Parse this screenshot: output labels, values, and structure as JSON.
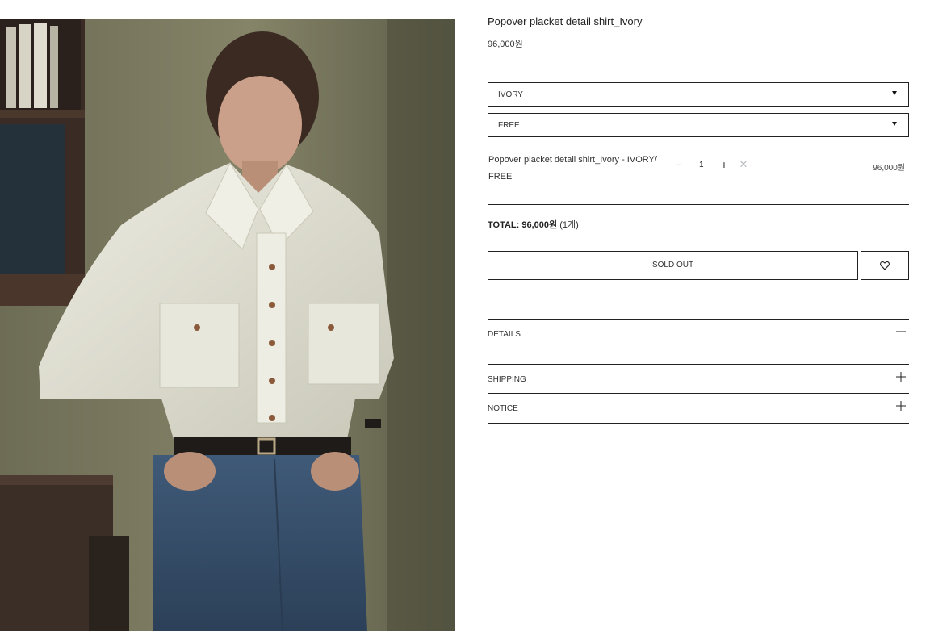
{
  "product": {
    "title": "Popover placket detail shirt_Ivory",
    "price": "96,000원",
    "image_alt": "Model wearing ivory popover placket shirt with jeans"
  },
  "options": {
    "color": "IVORY",
    "size": "FREE"
  },
  "cart_line": {
    "name": "Popover placket detail shirt_Ivory - IVORY/ FREE",
    "quantity": "1",
    "minus_label": "−",
    "plus_label": "+",
    "remove_label": "✕",
    "price": "96,000원"
  },
  "total": {
    "label": "TOTAL:",
    "amount": "96,000원",
    "count": "(1개)"
  },
  "buttons": {
    "sold_out": "SOLD OUT",
    "wishlist_icon": "heart-icon"
  },
  "accordion": {
    "details": "DETAILS",
    "shipping": "SHIPPING",
    "notice": "NOTICE"
  },
  "colors": {
    "border": "#222222",
    "remove_icon": "#b8bcc4"
  }
}
